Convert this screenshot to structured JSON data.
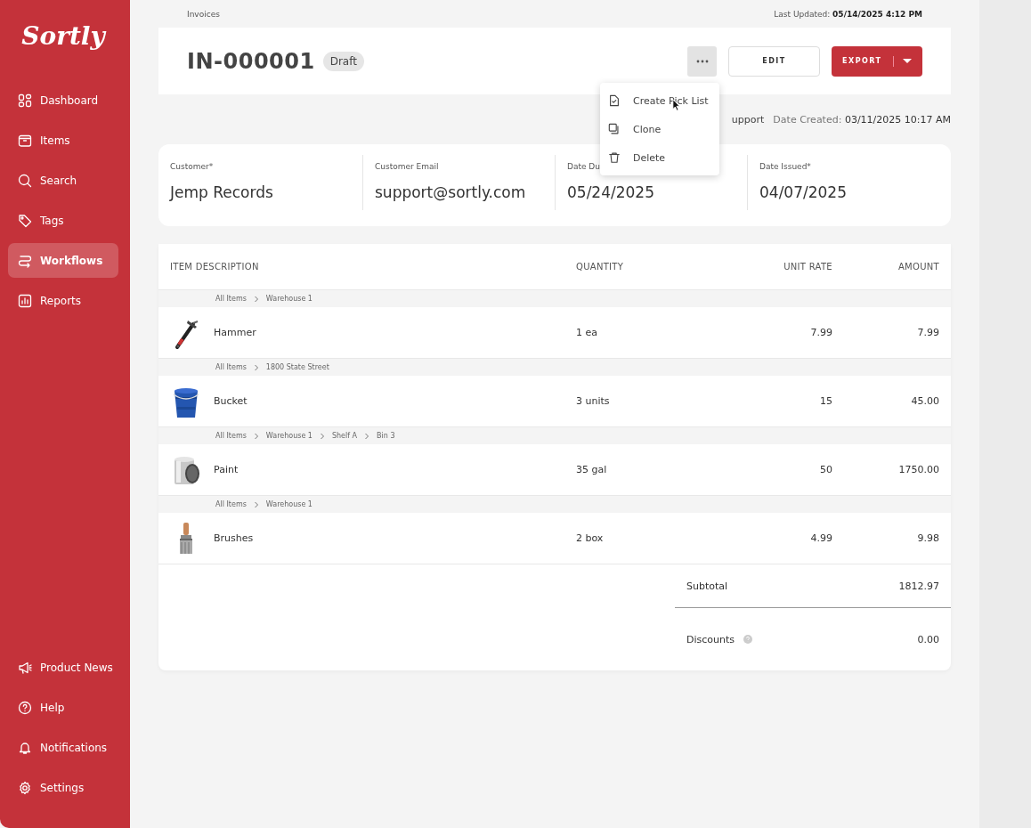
{
  "sidebar": {
    "logo": "Sortly",
    "items": [
      {
        "label": "Dashboard",
        "selected": false
      },
      {
        "label": "Items",
        "selected": false
      },
      {
        "label": "Search",
        "selected": false
      },
      {
        "label": "Tags",
        "selected": false
      },
      {
        "label": "Workflows",
        "selected": true
      },
      {
        "label": "Reports",
        "selected": false
      }
    ],
    "bottom_items": [
      {
        "label": "Product News"
      },
      {
        "label": "Help"
      },
      {
        "label": "Notifications"
      },
      {
        "label": "Settings"
      }
    ]
  },
  "breadcrumb": "Invoices",
  "last_updated": {
    "label": "Last Updated:",
    "value": "05/14/2025 4:12 PM"
  },
  "header": {
    "title": "IN-000001",
    "status": "Draft",
    "edit_button": "EDIT",
    "export_button": "EXPORT"
  },
  "more_menu": {
    "items": [
      {
        "label": "Create Pick List"
      },
      {
        "label": "Clone"
      },
      {
        "label": "Delete"
      }
    ]
  },
  "meta": {
    "created_by_fragment": "upport",
    "date_created_label": "Date Created:",
    "date_created": "03/11/2025 10:17 AM"
  },
  "fields": [
    {
      "label": "Customer*",
      "value": "Jemp Records"
    },
    {
      "label": "Customer Email",
      "value": "support@sortly.com"
    },
    {
      "label": "Date Du",
      "value": "05/24/2025"
    },
    {
      "label": "Date Issued*",
      "value": "04/07/2025"
    }
  ],
  "table": {
    "columns": [
      "ITEM DESCRIPTION",
      "QUANTITY",
      "UNIT RATE",
      "AMOUNT"
    ],
    "rows": [
      {
        "path": [
          "All Items",
          "Warehouse 1"
        ],
        "name": "Hammer",
        "quantity": "1 ea",
        "unit_rate": "7.99",
        "amount": "7.99"
      },
      {
        "path": [
          "All Items",
          "1800 State Street"
        ],
        "name": "Bucket",
        "quantity": "3 units",
        "unit_rate": "15",
        "amount": "45.00"
      },
      {
        "path": [
          "All Items",
          "Warehouse 1",
          "Shelf A",
          "Bin 3"
        ],
        "name": "Paint",
        "quantity": "35 gal",
        "unit_rate": "50",
        "amount": "1750.00"
      },
      {
        "path": [
          "All Items",
          "Warehouse 1"
        ],
        "name": "Brushes",
        "quantity": "2 box",
        "unit_rate": "4.99",
        "amount": "9.98"
      }
    ],
    "totals": [
      {
        "label": "Subtotal",
        "value": "1812.97",
        "help": false
      },
      {
        "label": "Discounts",
        "value": "0.00",
        "help": true
      }
    ]
  }
}
